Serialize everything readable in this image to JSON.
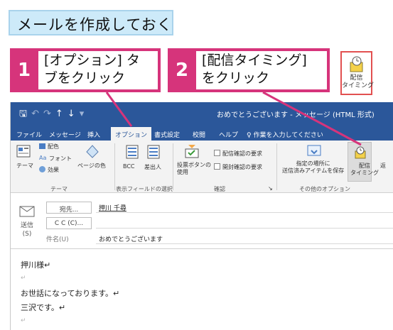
{
  "heading": "メールを作成しておく",
  "steps": [
    {
      "num": "1",
      "text": "[オプション] タ\nブをクリック"
    },
    {
      "num": "2",
      "text": "[配信タイミング]\nをクリック"
    }
  ],
  "float_icon_label": "配信\nタイミング",
  "window": {
    "title": "おめでとうございます - メッセージ (HTML 形式)",
    "tabs": [
      "ファイル",
      "メッセージ",
      "挿入",
      "オプション",
      "書式設定",
      "校閲",
      "ヘルプ",
      "作業を入力してください"
    ],
    "ribbon": {
      "theme": "テーマ",
      "color": "配色",
      "font": "フォント",
      "effect": "効果",
      "page_color": "ページの色",
      "group_theme": "テーマ",
      "bcc": "BCC",
      "from": "差出人",
      "group_fields": "表示フィールドの選択",
      "voting": "投票ボタンの\n使用",
      "delivery_receipt": "配信確認の要求",
      "read_receipt": "開封確認の要求",
      "group_tracking": "確認",
      "save_sent": "指定の場所に\n送信済みアイテムを保存",
      "delay_delivery": "配信\nタイミング",
      "more": "返",
      "group_more": "その他のオプション"
    },
    "header": {
      "send": "送信\n(S)",
      "to_label": "宛先...",
      "to_value": "押川 千尋",
      "cc_label": "C C (C)...",
      "cc_value": "",
      "subject_label": "件名(U)",
      "subject_value": "おめでとうございます"
    },
    "body_lines": [
      "押川様↵",
      "↵",
      "お世話になっております。↵",
      "三沢です。↵",
      "↵"
    ]
  },
  "colors": {
    "accent": "#d6347b",
    "titlebar": "#2b579a",
    "heading_bg": "#cdeaf9"
  }
}
